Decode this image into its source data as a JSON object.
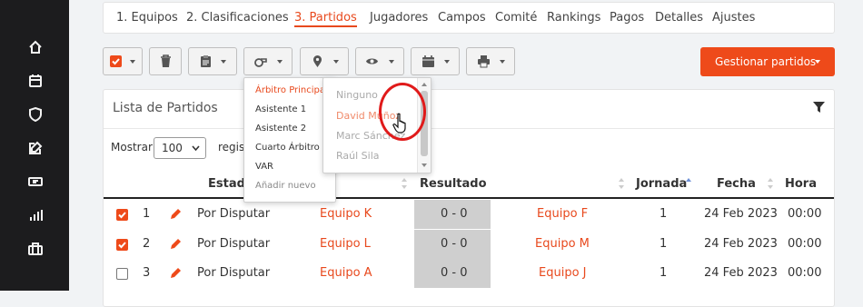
{
  "sidebar": {
    "icons": [
      "home-icon",
      "calendar-icon",
      "shield-icon",
      "edit-icon",
      "ticket-icon",
      "bar-chart-icon",
      "briefcase-icon"
    ]
  },
  "tabs": [
    {
      "label": "1. Equipos"
    },
    {
      "label": "2. Clasificaciones"
    },
    {
      "label": "3. Partidos",
      "active": true
    },
    {
      "label": "Jugadores"
    },
    {
      "label": "Campos"
    },
    {
      "label": "Comité"
    },
    {
      "label": "Rankings"
    },
    {
      "label": "Pagos"
    },
    {
      "label": "Detalles"
    },
    {
      "label": "Ajustes"
    }
  ],
  "toolbar": {
    "buttons": [
      "select-checkbox-icon",
      "trash-icon",
      "clipboard-icon",
      "whistle-icon",
      "location-pin-icon",
      "eye-icon",
      "calendar-icon",
      "print-icon"
    ],
    "manage_label": "Gestionar partidos"
  },
  "colors": {
    "accent": "#ee4a1a",
    "sidebar": "#1c1c1e",
    "score_bg": "#cfcfcf"
  },
  "panel": {
    "title": "Lista de Partidos",
    "show_label": "Mostrar",
    "page_size": "100",
    "records_label": "regist"
  },
  "columns": {
    "estado": "Estado",
    "resultado": "Resultado",
    "jornada": "Jornada",
    "fecha": "Fecha",
    "hora": "Hora"
  },
  "rows": [
    {
      "checked": true,
      "num": "1",
      "status": "Por Disputar",
      "home": "Equipo K",
      "score": "0 - 0",
      "away": "Equipo F",
      "jornada": "1",
      "fecha": "24 Feb 2023",
      "hora": "00:00"
    },
    {
      "checked": true,
      "num": "2",
      "status": "Por Disputar",
      "home": "Equipo L",
      "score": "0 - 0",
      "away": "Equipo M",
      "jornada": "1",
      "fecha": "24 Feb 2023",
      "hora": "00:00"
    },
    {
      "checked": false,
      "num": "3",
      "status": "Por Disputar",
      "home": "Equipo A",
      "score": "0 - 0",
      "away": "Equipo J",
      "jornada": "1",
      "fecha": "24 Feb 2023",
      "hora": "00:00"
    }
  ],
  "referee_menu": {
    "items": [
      "Árbitro Principal",
      "Asistente 1",
      "Asistente 2",
      "Cuarto Árbitro",
      "VAR",
      "Añadir nuevo"
    ],
    "selected": "Árbitro Principal"
  },
  "referee_submenu": {
    "items": [
      "Ninguno",
      "David Muñoz",
      "Marc Sánchez",
      "Raúl Sila"
    ],
    "hovered": "David Muñoz"
  }
}
